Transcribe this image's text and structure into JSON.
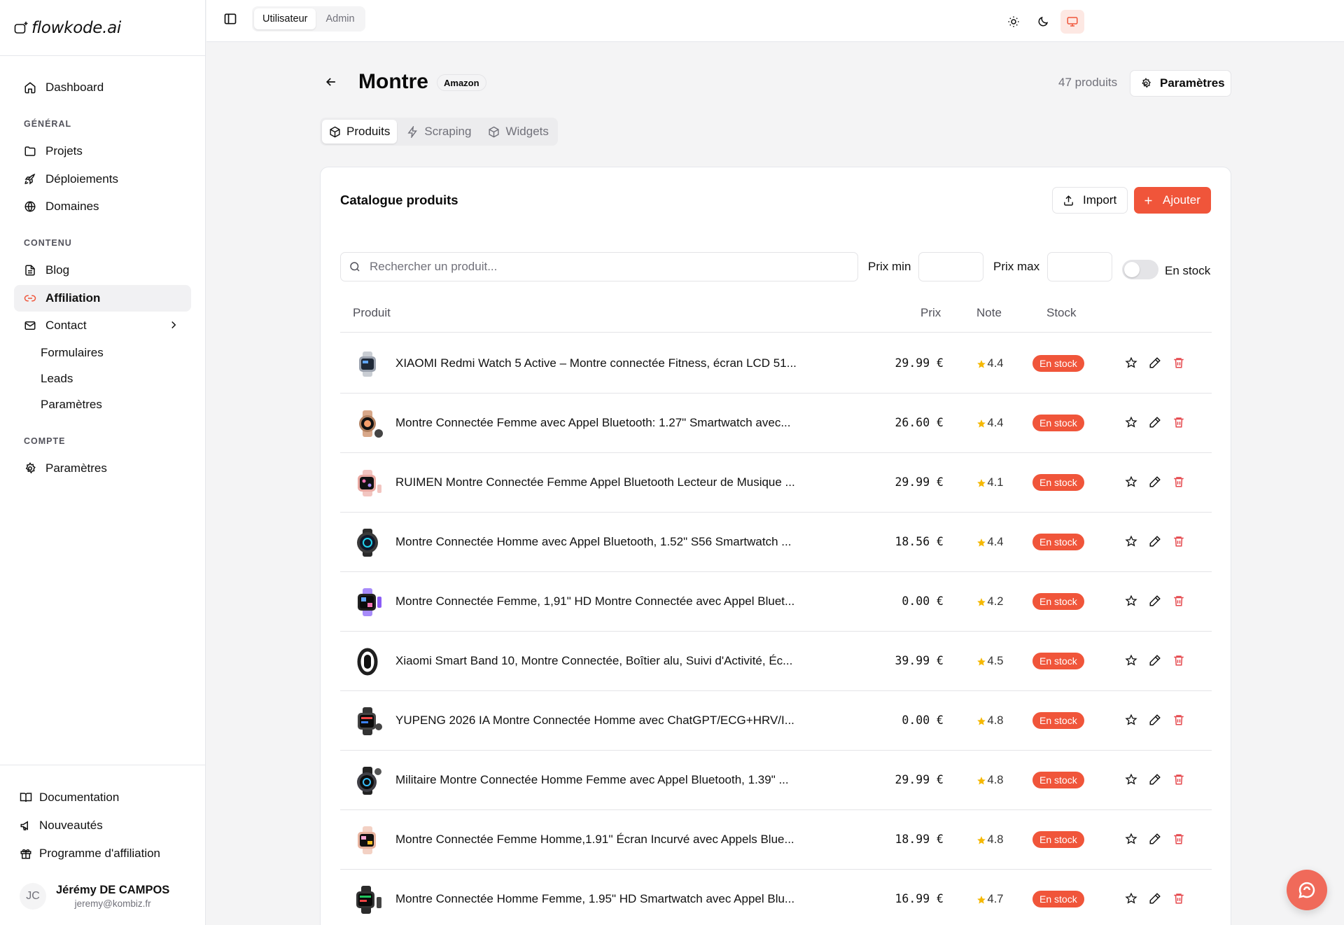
{
  "app": {
    "logo_text": "flowkode.ai"
  },
  "sidebar": {
    "dashboard": "Dashboard",
    "sections": {
      "general": "GÉNÉRAL",
      "content": "CONTENU",
      "account": "COMPTE"
    },
    "general_items": [
      "Projets",
      "Déploiements",
      "Domaines"
    ],
    "content_items": {
      "blog": "Blog",
      "affiliation": "Affiliation",
      "contact": "Contact"
    },
    "contact_sub": [
      "Formulaires",
      "Leads",
      "Paramètres"
    ],
    "account_items": [
      "Paramètres"
    ],
    "bottom_items": [
      "Documentation",
      "Nouveautés",
      "Programme d'affiliation"
    ],
    "user": {
      "initials": "JC",
      "name": "Jérémy DE CAMPOS",
      "email": "jeremy@kombiz.fr"
    }
  },
  "topbar": {
    "modes": [
      "Utilisateur",
      "Admin"
    ],
    "active_mode": "Utilisateur"
  },
  "page": {
    "title": "Montre",
    "badge": "Amazon",
    "count": "47 produits",
    "settings_button": "Paramètres",
    "tabs": [
      "Produits",
      "Scraping",
      "Widgets"
    ]
  },
  "catalog": {
    "title": "Catalogue produits",
    "import_button": "Import",
    "add_button": "Ajouter",
    "search_placeholder": "Rechercher un produit...",
    "price_min_label": "Prix min",
    "price_max_label": "Prix max",
    "in_stock_label": "En stock",
    "columns": {
      "product": "Produit",
      "price": "Prix",
      "rating": "Note",
      "stock": "Stock"
    },
    "products": [
      {
        "name": "XIAOMI Redmi Watch 5 Active – Montre connectée Fitness, écran LCD 51...",
        "price": "29.99 €",
        "rating": "4.4",
        "stock": "En stock"
      },
      {
        "name": "Montre Connectée Femme avec Appel Bluetooth: 1.27\" Smartwatch avec...",
        "price": "26.60 €",
        "rating": "4.4",
        "stock": "En stock"
      },
      {
        "name": "RUIMEN Montre Connectée Femme Appel Bluetooth Lecteur de Musique ...",
        "price": "29.99 €",
        "rating": "4.1",
        "stock": "En stock"
      },
      {
        "name": "Montre Connectée Homme avec Appel Bluetooth, 1.52\" S56 Smartwatch ...",
        "price": "18.56 €",
        "rating": "4.4",
        "stock": "En stock"
      },
      {
        "name": "Montre Connectée Femme, 1,91\" HD Montre Connectée avec Appel Bluet...",
        "price": "0.00 €",
        "rating": "4.2",
        "stock": "En stock"
      },
      {
        "name": "Xiaomi Smart Band 10, Montre Connectée, Boîtier alu, Suivi d'Activité, Éc...",
        "price": "39.99 €",
        "rating": "4.5",
        "stock": "En stock"
      },
      {
        "name": "YUPENG 2026 IA Montre Connectée Homme avec ChatGPT/ECG+HRV/I...",
        "price": "0.00 €",
        "rating": "4.8",
        "stock": "En stock"
      },
      {
        "name": "Militaire Montre Connectée Homme Femme avec Appel Bluetooth, 1.39\" ...",
        "price": "29.99 €",
        "rating": "4.8",
        "stock": "En stock"
      },
      {
        "name": "Montre Connectée Femme Homme,1.91'' Écran Incurvé avec Appels Blue...",
        "price": "18.99 €",
        "rating": "4.8",
        "stock": "En stock"
      },
      {
        "name": "Montre Connectée Homme Femme, 1.95\" HD Smartwatch avec Appel Blu...",
        "price": "16.99 €",
        "rating": "4.7",
        "stock": "En stock"
      }
    ]
  },
  "colors": {
    "accent": "#f0553a",
    "star": "#f5b800",
    "delete": "#e5484d"
  }
}
